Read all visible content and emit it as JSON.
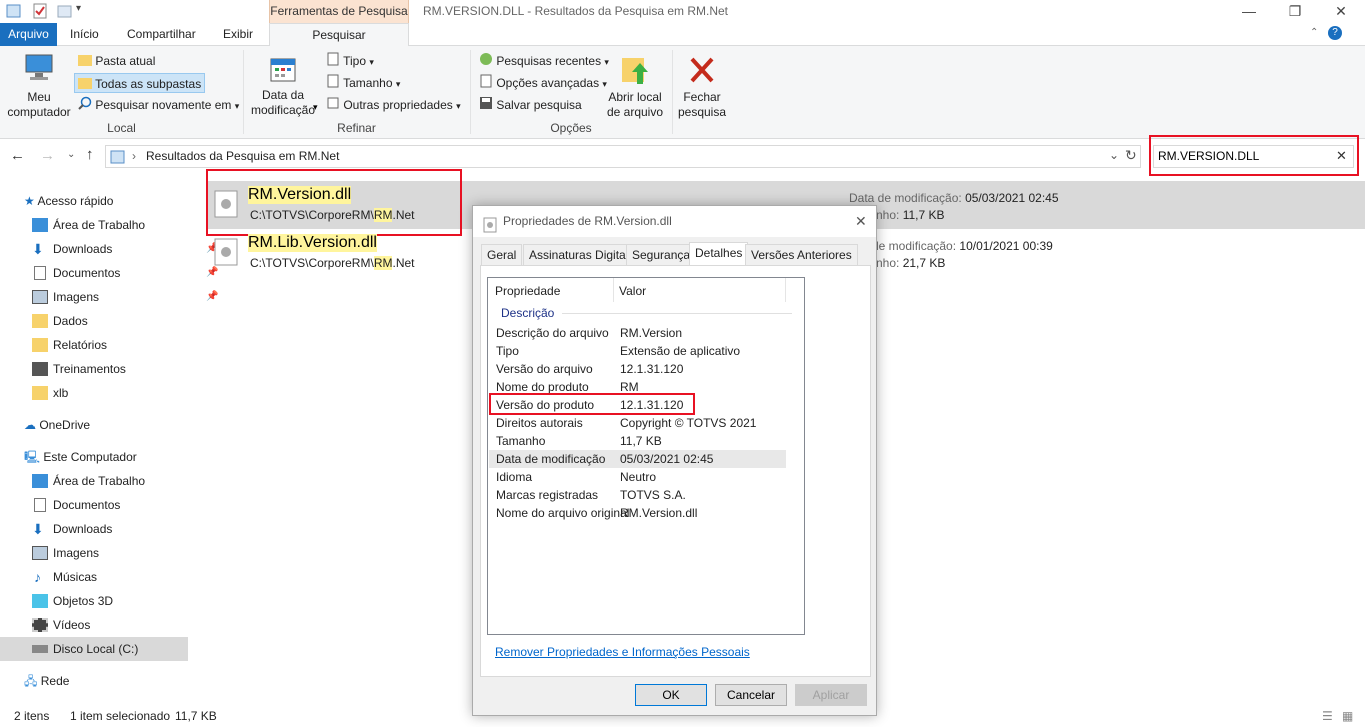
{
  "titlebar": {
    "context_tab": "Ferramentas de Pesquisa",
    "window_title": "RM.VERSION.DLL - Resultados da Pesquisa em RM.Net",
    "minimize": "—",
    "maximize": "❐",
    "close": "✕"
  },
  "ribbon_tabs": {
    "file": "Arquivo",
    "home": "Início",
    "share": "Compartilhar",
    "view": "Exibir",
    "search": "Pesquisar",
    "help": "?"
  },
  "ribbon": {
    "local": {
      "my_computer": "Meu\ncomputador",
      "current_folder": "Pasta atual",
      "all_subfolders": "Todas as subpastas",
      "search_again": "Pesquisar novamente em",
      "group_label": "Local"
    },
    "refine": {
      "date_modified": "Data da\nmodificação",
      "type": "Tipo",
      "size": "Tamanho",
      "other_props": "Outras propriedades",
      "group_label": "Refinar"
    },
    "options": {
      "recent_searches": "Pesquisas recentes",
      "advanced_options": "Opções avançadas",
      "save_search": "Salvar pesquisa",
      "open_location": "Abrir local\nde arquivo",
      "group_label": "Opções"
    },
    "close_search": "Fechar\npesquisa"
  },
  "address": {
    "breadcrumb": "Resultados da Pesquisa em RM.Net",
    "search_value": "RM.VERSION.DLL"
  },
  "nav": {
    "quick_access": "Acesso rápido",
    "qa_items": [
      "Área de Trabalho",
      "Downloads",
      "Documentos",
      "Imagens",
      "Dados",
      "Relatórios",
      "Treinamentos",
      "xlb"
    ],
    "onedrive": "OneDrive",
    "this_pc": "Este Computador",
    "pc_items": [
      "Área de Trabalho",
      "Documentos",
      "Downloads",
      "Imagens",
      "Músicas",
      "Objetos 3D",
      "Vídeos",
      "Disco Local (C:)"
    ],
    "network": "Rede"
  },
  "files": [
    {
      "name": "RM.Version.dll",
      "path_pre": "C:\\TOTVS\\CorporeRM\\",
      "path_hl": "RM",
      "path_post": ".Net",
      "date_label": "Data de modificação:",
      "date": "05/03/2021 02:45",
      "size_label": "nho:",
      "size": "11,7 KB"
    },
    {
      "name": "RM.Lib.Version.dll",
      "path_pre": "C:\\TOTVS\\CorporeRM\\",
      "path_hl": "RM",
      "path_post": ".Net",
      "date_label": "de modificação:",
      "date": "10/01/2021 00:39",
      "size_label": "nho:",
      "size": "21,7 KB"
    }
  ],
  "status": {
    "count": "2 itens",
    "selected": "1 item selecionado",
    "size": "11,7 KB"
  },
  "dialog": {
    "title": "Propriedades de RM.Version.dll",
    "tabs": [
      "Geral",
      "Assinaturas Digitais",
      "Segurança",
      "Detalhes",
      "Versões Anteriores"
    ],
    "col_property": "Propriedade",
    "col_value": "Valor",
    "section": "Descrição",
    "rows": [
      {
        "k": "Descrição do arquivo",
        "v": "RM.Version"
      },
      {
        "k": "Tipo",
        "v": "Extensão de aplicativo"
      },
      {
        "k": "Versão do arquivo",
        "v": "12.1.31.120"
      },
      {
        "k": "Nome do produto",
        "v": "RM"
      },
      {
        "k": "Versão do produto",
        "v": "12.1.31.120"
      },
      {
        "k": "Direitos autorais",
        "v": "Copyright © TOTVS 2021"
      },
      {
        "k": "Tamanho",
        "v": "11,7 KB"
      },
      {
        "k": "Data de modificação",
        "v": "05/03/2021 02:45"
      },
      {
        "k": "Idioma",
        "v": "Neutro"
      },
      {
        "k": "Marcas registradas",
        "v": "TOTVS S.A."
      },
      {
        "k": "Nome do arquivo original",
        "v": "RM.Version.dll"
      }
    ],
    "remove_link": "Remover Propriedades e Informações Pessoais",
    "ok": "OK",
    "cancel": "Cancelar",
    "apply": "Aplicar"
  },
  "colors": {
    "accent": "#1a6fbf",
    "context_tab": "#fbe3d1",
    "highlight": "#fff59d",
    "selection": "#d9d9d9",
    "annotation_red": "#e81123"
  }
}
